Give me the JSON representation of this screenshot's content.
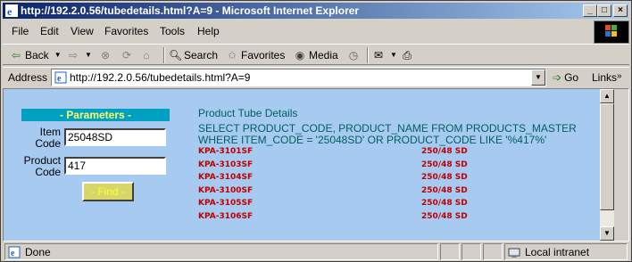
{
  "window": {
    "title": "http://192.2.0.56/tubedetails.html?A=9 - Microsoft Internet Explorer",
    "minimize": "_",
    "maximize": "□",
    "close": "×"
  },
  "menu": {
    "file": "File",
    "edit": "Edit",
    "view": "View",
    "favorites": "Favorites",
    "tools": "Tools",
    "help": "Help"
  },
  "toolbar": {
    "back": "Back",
    "search": "Search",
    "favorites": "Favorites",
    "media": "Media"
  },
  "address": {
    "label": "Address",
    "url": "http://192.2.0.56/tubedetails.html?A=9",
    "go": "Go",
    "links": "Links"
  },
  "form": {
    "header": "- Parameters -",
    "item_code_label_1": "Item",
    "item_code_label_2": "Code",
    "item_code_value": "25048SD",
    "product_code_label_1": "Product",
    "product_code_label_2": "Code",
    "product_code_value": "417",
    "find_button": "Find"
  },
  "results": {
    "title": "Product Tube Details",
    "sql": "SELECT PRODUCT_CODE, PRODUCT_NAME FROM PRODUCTS_MASTER WHERE ITEM_CODE = '25048SD' OR PRODUCT_CODE LIKE '%417%'",
    "rows": [
      {
        "code": "KPA-3101SF",
        "name": "250/48 SD"
      },
      {
        "code": "KPA-3103SF",
        "name": "250/48 SD"
      },
      {
        "code": "KPA-3104SF",
        "name": "250/48 SD"
      },
      {
        "code": "KPA-3100SF",
        "name": "250/48 SD"
      },
      {
        "code": "KPA-3105SF",
        "name": "250/48 SD"
      },
      {
        "code": "KPA-3106SF",
        "name": "250/48 SD"
      }
    ]
  },
  "status": {
    "left": "Done",
    "zone": "Local intranet"
  },
  "colors": {
    "page_bg": "#a6caf0",
    "sql_text": "#006060",
    "row_text": "#c00000",
    "panel_head_bg": "#00a0c0"
  }
}
